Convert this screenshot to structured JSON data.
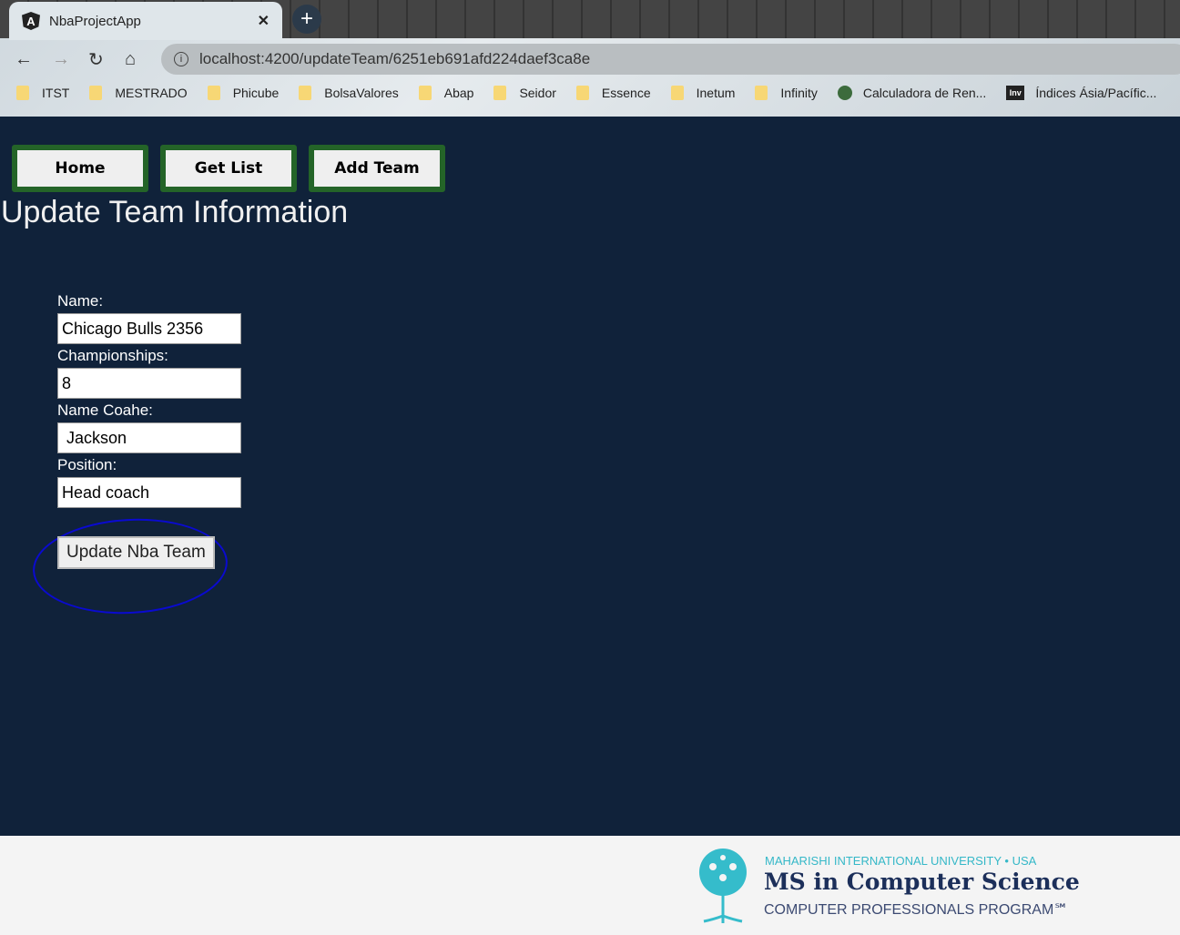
{
  "browser": {
    "tab_title": "NbaProjectApp",
    "url": "localhost:4200/updateTeam/6251eb691afd224daef3ca8e",
    "bookmarks": [
      "ITST",
      "MESTRADO",
      "Phicube",
      "BolsaValores",
      "Abap",
      "Seidor",
      "Essence",
      "Inetum",
      "Infinity",
      "Calculadora de Ren...",
      "Índices Ásia/Pacífic..."
    ]
  },
  "nav": {
    "home": "Home",
    "get_list": "Get List",
    "add_team": "Add Team"
  },
  "page_title": "Update Team Information",
  "form": {
    "name_label": "Name:",
    "name_value": "Chicago Bulls 2356",
    "championships_label": "Championships:",
    "championships_value": "8",
    "coach_label": "Name Coahe:",
    "coach_value": " Jackson",
    "position_label": "Position:",
    "position_value": "Head coach",
    "submit": "Update Nba Team"
  },
  "footer": {
    "university": "MAHARISHI INTERNATIONAL UNIVERSITY • USA",
    "program": "MS in Computer Science",
    "subtitle": "COMPUTER PROFESSIONALS PROGRAM℠"
  }
}
